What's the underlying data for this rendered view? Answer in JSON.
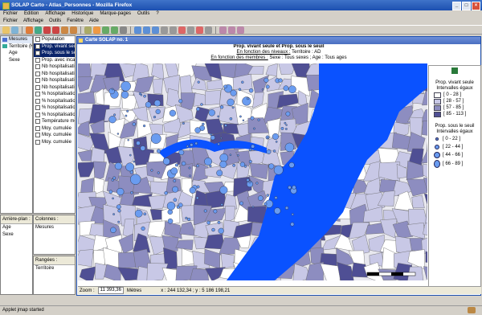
{
  "window": {
    "title": "SOLAP Carto - Atlas_Personnes - Mozilla Firefox"
  },
  "browser_menu": [
    "Fichier",
    "Edition",
    "Affichage",
    "Historique",
    "Marque-pages",
    "Outils",
    "?"
  ],
  "app_menu": [
    "Fichier",
    "Affichage",
    "Outils",
    "Fenêtre",
    "Aide"
  ],
  "dimensions": {
    "items": [
      "Mesures",
      "Territoire (H)",
      "Age",
      "Sexe"
    ]
  },
  "measures": {
    "items": [
      "Population",
      "Prop. vivant seule",
      "Prop. sous le seuil",
      "Prop. avec incapacité",
      "Nb hospitalisations",
      "Nb hospitalisations",
      "Nb hospitalisations",
      "Nb hospitalisations",
      "% hospitalisations",
      "% hospitalisations",
      "% hospitalisations",
      "% hospitalisations",
      "Température moyenne",
      "Moy. cumulée",
      "Moy. cumulée",
      "Moy. cumulée"
    ]
  },
  "arriere_plan": {
    "header": "Arrière-plan :",
    "items": [
      "Age",
      "Sexe"
    ]
  },
  "colonnes": {
    "header": "Colonnes :",
    "items": [
      "Mesures"
    ]
  },
  "rangees": {
    "header": "Rangées :",
    "items": [
      "Territoire"
    ]
  },
  "map_window": {
    "tab_label": "Carte SOLAP no. 1",
    "title": "Prop. vivant seule et Prop. sous le seuil",
    "line2_prefix": "En fonction des niveaux :",
    "line2_value": "Territoire : AD",
    "line3_prefix": "En fonction des membres :",
    "line3_value": "Sexe : Tous sexes ; Age : Tous ages"
  },
  "legend": {
    "title1": "Prop. vivant seule",
    "subtitle1": "Intervalles égaux",
    "classes1": [
      "[ 0 - 28 ]",
      "[ 28 - 57 ]",
      "[ 57 - 85 ]",
      "[ 85 - 113 ]"
    ],
    "colors1": [
      "#ffffff",
      "#c8c8e6",
      "#8d8dc0",
      "#4f4f94"
    ],
    "title2": "Prop. sous le seuil",
    "subtitle2": "Intervalles égaux",
    "classes2": [
      "[ 0 - 22 ]",
      "[ 22 - 44 ]",
      "[ 44 - 66 ]",
      "[ 66 - 89 ]"
    ]
  },
  "zoom": {
    "label": "Zoom :",
    "value": "11 393,36",
    "unit": "Mètres",
    "coords": "x : 244 132,34 ; y : 5 186 198,21"
  },
  "status": {
    "text": "Applet jmap started"
  },
  "colors": {
    "water": "#0a52ff",
    "accent": "#1c4fb0",
    "bubble": "#6a9cf0"
  }
}
